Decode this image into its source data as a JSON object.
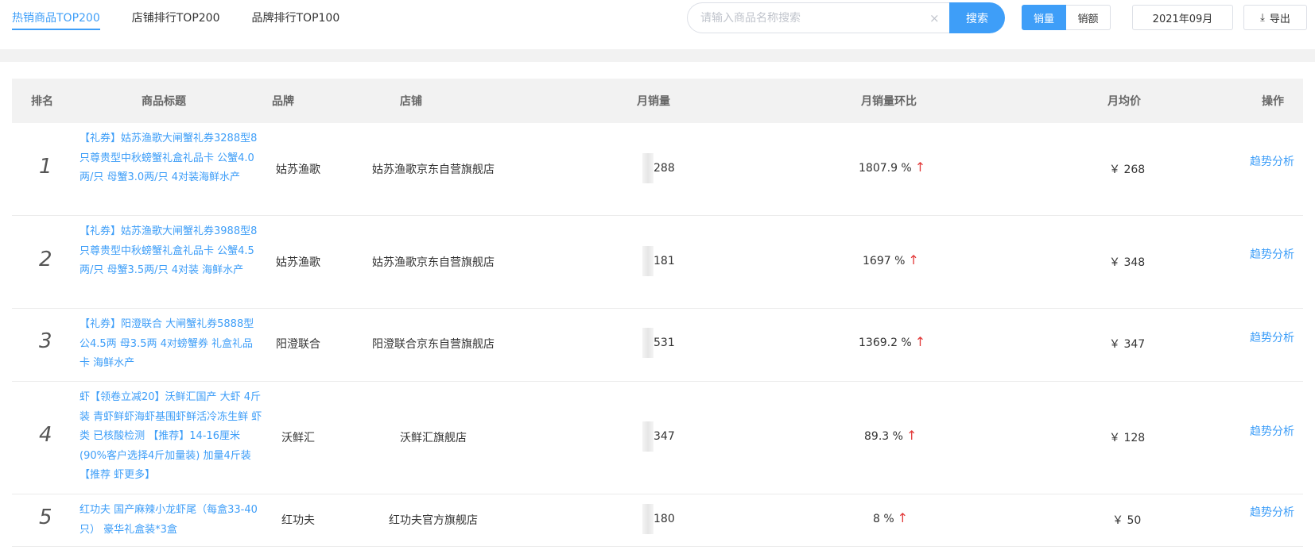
{
  "tabs": [
    "热销商品TOP200",
    "店铺排行TOP200",
    "品牌排行TOP100"
  ],
  "search": {
    "placeholder": "请输入商品名称搜索",
    "button": "搜索",
    "clear": "×"
  },
  "toggle": {
    "on": "销量",
    "off": "销额"
  },
  "date": "2021年09月",
  "export": {
    "label": "导出",
    "icon": "⤓"
  },
  "table": {
    "headers": [
      "排名",
      "商品标题",
      "品牌",
      "店铺",
      "月销量",
      "月销量环比",
      "月均价",
      "操作"
    ],
    "rows": [
      {
        "rank": "1",
        "title": "【礼券】姑苏渔歌大闸蟹礼券3288型8只尊贵型中秋螃蟹礼盒礼品卡 公蟹4.0两/只 母蟹3.0两/只 4对装海鲜水产",
        "brand": "姑苏渔歌",
        "shop": "姑苏渔歌京东自营旗舰店",
        "sales": "288",
        "ratio": "1807.9 %",
        "price": "￥ 268",
        "action": "趋势分析"
      },
      {
        "rank": "2",
        "title": "【礼券】姑苏渔歌大闸蟹礼券3988型8只尊贵型中秋螃蟹礼盒礼品卡 公蟹4.5两/只 母蟹3.5两/只 4对装 海鲜水产",
        "brand": "姑苏渔歌",
        "shop": "姑苏渔歌京东自营旗舰店",
        "sales": "181",
        "ratio": "1697 %",
        "price": "￥ 348",
        "action": "趋势分析"
      },
      {
        "rank": "3",
        "title": "【礼券】阳澄联合 大闸蟹礼券5888型公4.5两 母3.5两 4对螃蟹券 礼盒礼品卡 海鲜水产",
        "brand": "阳澄联合",
        "shop": "阳澄联合京东自营旗舰店",
        "sales": "531",
        "ratio": "1369.2 %",
        "price": "￥ 347",
        "action": "趋势分析"
      },
      {
        "rank": "4",
        "title": "虾【领卷立减20】沃鲜汇国产 大虾 4斤装 青虾鲜虾海虾基围虾鲜活冷冻生鲜 虾类 已核酸检测 【推荐】14-16厘米(90%客户选择4斤加量装) 加量4斤装【推荐 虾更多】",
        "brand": "沃鲜汇",
        "shop": "沃鲜汇旗舰店",
        "sales": "347",
        "ratio": "89.3 %",
        "price": "￥ 128",
        "action": "趋势分析"
      },
      {
        "rank": "5",
        "title": "红功夫 国产麻辣小龙虾尾（每盒33-40只） 豪华礼盒装*3盒",
        "brand": "红功夫",
        "shop": "红功夫官方旗舰店",
        "sales": "180",
        "ratio": "8 %",
        "price": "￥ 50",
        "action": "趋势分析"
      }
    ]
  },
  "up_arrow": "↑",
  "colors": {
    "accent": "#3e9ef8",
    "up": "#e23a3a",
    "band": "#f2f2f2"
  }
}
